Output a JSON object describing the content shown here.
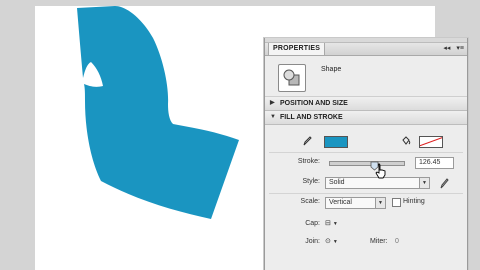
{
  "panel": {
    "tab_label": "PROPERTIES",
    "header_buttons": [
      "◂◂",
      "▾≡"
    ],
    "shape_type": "Shape"
  },
  "sections": {
    "position_size": {
      "label": "POSITION AND SIZE",
      "expanded": false
    },
    "fill_stroke": {
      "label": "FILL AND STROKE",
      "expanded": true
    }
  },
  "fill_stroke": {
    "fill_icon": "paint-bucket-icon",
    "fill_color": "#1a95c1",
    "stroke_icon": "ink-bottle-icon",
    "stroke_color": "none",
    "stroke_label": "Stroke:",
    "stroke_value": "126.45",
    "stroke_slider_fraction": 0.62,
    "style_label": "Style:",
    "style_value": "Solid",
    "scale_label": "Scale:",
    "scale_value": "Vertical",
    "hinting_label": "Hinting",
    "hinting_checked": false,
    "cap_label": "Cap:",
    "cap_value": "⊟",
    "join_label": "Join:",
    "join_value": "⊙",
    "miter_label": "Miter:",
    "miter_value": "0"
  },
  "colors": {
    "shape_fill": "#1a95c1",
    "canvas": "#ffffff",
    "stage": "#d4d4d4"
  }
}
